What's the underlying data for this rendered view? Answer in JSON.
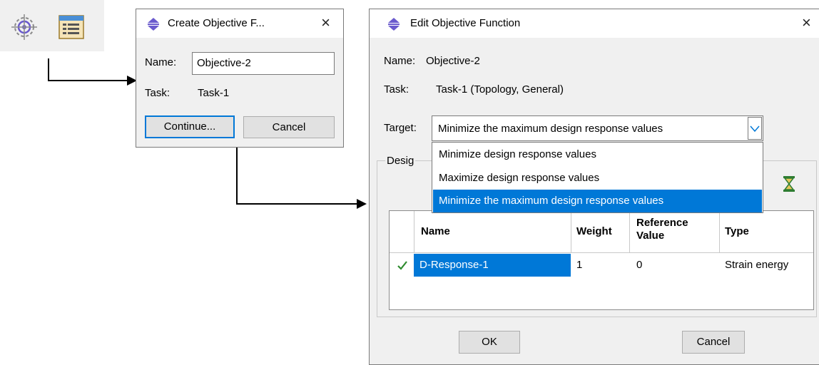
{
  "toolbar": {
    "icons": [
      "objective-target-icon",
      "objective-manager-icon"
    ]
  },
  "create_dialog": {
    "title": "Create Objective F...",
    "close_glyph": "×",
    "name_label": "Name:",
    "name_value": "Objective-2",
    "task_label": "Task:",
    "task_value": "Task-1",
    "continue_label": "Continue...",
    "cancel_label": "Cancel"
  },
  "edit_dialog": {
    "title": "Edit Objective Function",
    "close_glyph": "×",
    "name_label": "Name:",
    "name_value": "Objective-2",
    "task_label": "Task:",
    "task_value": "Task-1 (Topology, General)",
    "target_label": "Target:",
    "target_value": "Minimize the maximum design response values",
    "target_options": [
      "Minimize design response values",
      "Maximize design response values",
      "Minimize the maximum design response values"
    ],
    "selected_option_index": 2,
    "group_label": "Desig",
    "table": {
      "headers": [
        "Name",
        "Weight",
        "Reference Value",
        "Type"
      ],
      "rows": [
        {
          "checked": true,
          "name": "D-Response-1",
          "weight": "1",
          "reference_value": "0",
          "type": "Strain energy"
        }
      ]
    },
    "ok_label": "OK",
    "cancel_label": "Cancel"
  },
  "colors": {
    "accent": "#0078d7",
    "title_icon": "#6a5acd",
    "check": "#2e8b2e",
    "hourglass": "#2e7d32"
  }
}
